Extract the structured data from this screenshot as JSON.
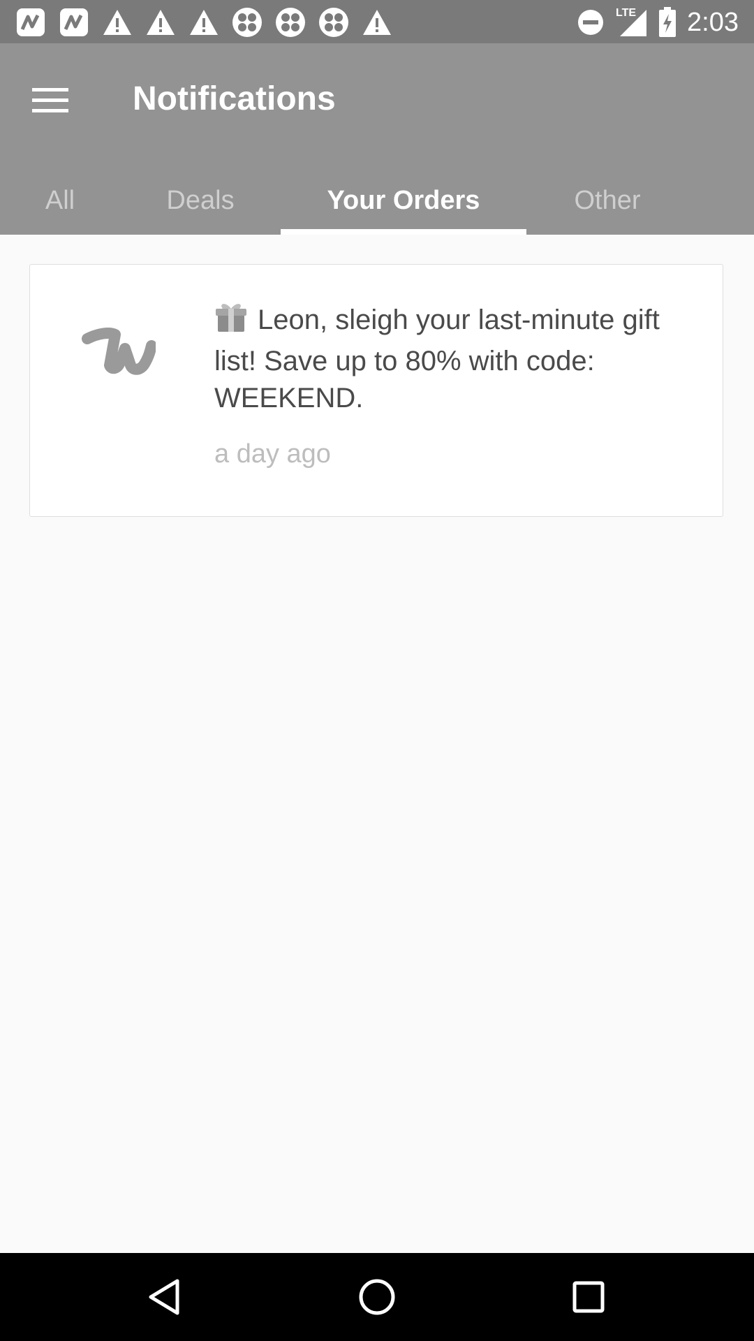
{
  "status_bar": {
    "time": "2:03",
    "network": "LTE",
    "left_icons": [
      "app-icon",
      "app-icon",
      "warning-icon",
      "warning-icon",
      "warning-icon",
      "clover-icon",
      "clover-icon",
      "clover-icon",
      "warning-icon"
    ],
    "right_icons": [
      "do-not-disturb-icon",
      "signal-icon",
      "battery-charging-icon"
    ]
  },
  "app_bar": {
    "title": "Notifications",
    "menu_icon": "hamburger-menu-icon",
    "background": "#939393"
  },
  "tabs": [
    {
      "label": "All",
      "active": false
    },
    {
      "label": "Deals",
      "active": false
    },
    {
      "label": "Your Orders",
      "active": true
    },
    {
      "label": "Other",
      "active": false
    }
  ],
  "notifications": [
    {
      "icon": "gift-icon",
      "logo": "wish-logo-icon",
      "message": "Leon, sleigh your last-minute gift list! Save up to 80% with code: WEEKEND.",
      "time": "a day ago"
    }
  ],
  "nav_bar": {
    "buttons": [
      "back-icon",
      "home-icon",
      "recents-icon"
    ]
  }
}
